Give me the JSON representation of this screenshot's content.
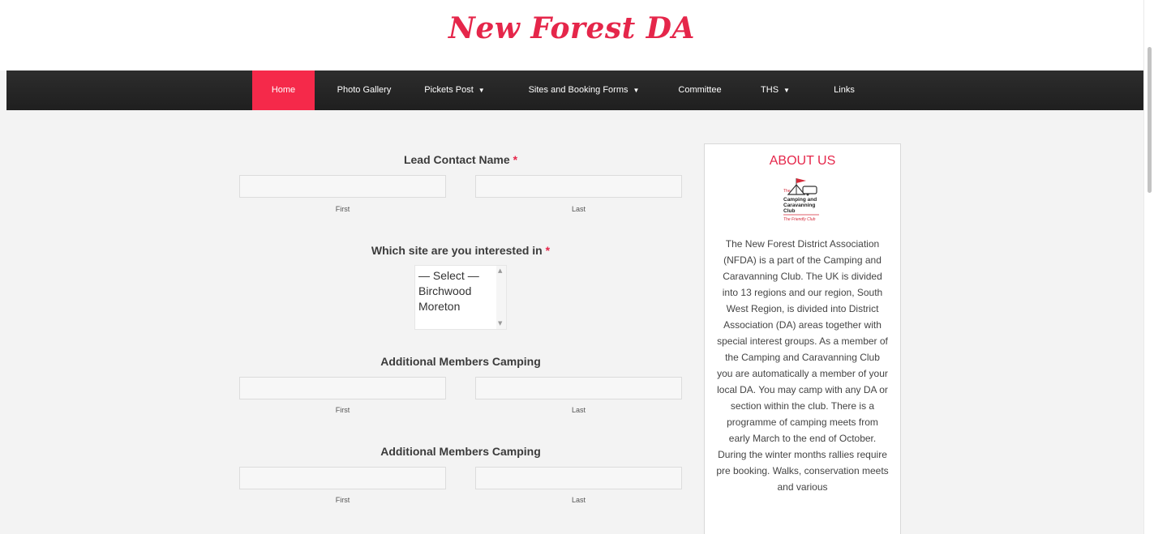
{
  "header": {
    "site_title": "New Forest DA"
  },
  "nav": {
    "items": [
      {
        "label": "Home",
        "has_dropdown": false,
        "active": true
      },
      {
        "label": "Photo Gallery",
        "has_dropdown": false
      },
      {
        "label": "Pickets Post",
        "has_dropdown": true
      },
      {
        "label": "Sites and Booking Forms",
        "has_dropdown": true
      },
      {
        "label": "Committee",
        "has_dropdown": false
      },
      {
        "label": "THS",
        "has_dropdown": true
      },
      {
        "label": "Links",
        "has_dropdown": false
      }
    ],
    "caret_glyph": "▼"
  },
  "form": {
    "lead_contact": {
      "label": "Lead Contact Name",
      "required_mark": "*",
      "first_sublabel": "First",
      "last_sublabel": "Last",
      "first_value": "",
      "last_value": ""
    },
    "site_select": {
      "label": "Which site are you interested in",
      "required_mark": "*",
      "options": [
        "— Select —",
        "Birchwood",
        "Moreton"
      ]
    },
    "additional_1": {
      "label": "Additional Members Camping",
      "first_sublabel": "First",
      "last_sublabel": "Last",
      "first_value": "",
      "last_value": ""
    },
    "additional_2": {
      "label": "Additional Members Camping",
      "first_sublabel": "First",
      "last_sublabel": "Last",
      "first_value": "",
      "last_value": ""
    }
  },
  "sidebar": {
    "title": "ABOUT US",
    "logo_icon": "camping-club-logo-icon",
    "logo_text": [
      "The",
      "Camping and",
      "Caravanning",
      "Club",
      "The Friendly Club"
    ],
    "about_text": "The New Forest District Association (NFDA) is a part of the Camping and Caravanning Club. The UK is divided into 13 regions and our region, South West Region, is divided into District Association (DA) areas together with special interest groups. As a member of the Camping and Caravanning Club you are automatically a member of your local DA. You may camp with any DA or section within the club. There is a programme of camping meets from early March to the end of October. During the winter months rallies require pre booking. Walks, conservation meets and various"
  },
  "colors": {
    "accent": "#e5264a",
    "nav_bg": "#262626",
    "nav_active": "#f5294a",
    "page_bg": "#f3f3f3"
  }
}
